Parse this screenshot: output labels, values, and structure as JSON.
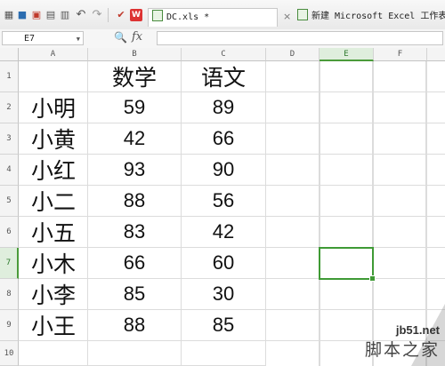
{
  "toolbar": {
    "icons": [
      "menu-grid-icon",
      "save-icon",
      "export-pdf-icon",
      "print-icon",
      "print-preview-icon",
      "undo-icon",
      "redo-icon",
      "format-painter-icon",
      "wps-logo-icon"
    ]
  },
  "tabs": [
    {
      "label": "DC.xls *",
      "close": "×"
    },
    {
      "label": "新建 Microsoft Excel 工作表.xl",
      "close": ""
    }
  ],
  "formula_bar": {
    "name_box": "E7",
    "fx": "fx",
    "content": ""
  },
  "columns": [
    "A",
    "B",
    "C",
    "D",
    "E",
    "F"
  ],
  "rows": [
    "1",
    "2",
    "3",
    "4",
    "5",
    "6",
    "7",
    "8",
    "9",
    "10"
  ],
  "selected": {
    "column": "E",
    "row": "7"
  },
  "table": {
    "headers": [
      "",
      "数学",
      "语文"
    ],
    "records": [
      {
        "name": "小明",
        "math": "59",
        "chinese": "89"
      },
      {
        "name": "小黄",
        "math": "42",
        "chinese": "66"
      },
      {
        "name": "小红",
        "math": "93",
        "chinese": "90"
      },
      {
        "name": "小二",
        "math": "88",
        "chinese": "56"
      },
      {
        "name": "小五",
        "math": "83",
        "chinese": "42"
      },
      {
        "name": "小木",
        "math": "66",
        "chinese": "60"
      },
      {
        "name": "小李",
        "math": "85",
        "chinese": "30"
      },
      {
        "name": "小王",
        "math": "88",
        "chinese": "85"
      }
    ]
  },
  "watermark": {
    "line1": "jb51.net",
    "line2": "脚本之家"
  },
  "colors": {
    "accent_green": "#3f9a35",
    "header_bg": "#f4f4f4",
    "gridline": "#dcdcdc"
  }
}
